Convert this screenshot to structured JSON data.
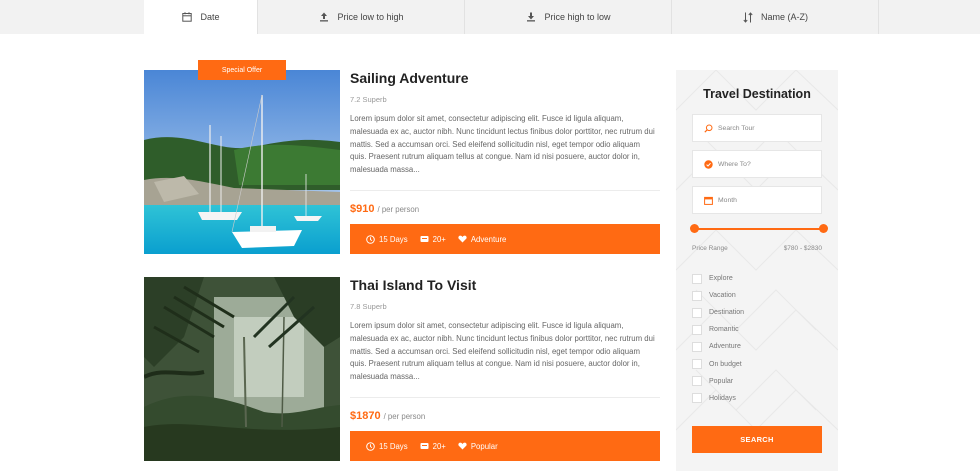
{
  "sort_tabs": [
    {
      "label": "Date",
      "icon": "calendar-icon",
      "active": true
    },
    {
      "label": "Price low to high",
      "icon": "upload-arrow-icon",
      "active": false
    },
    {
      "label": "Price high to low",
      "icon": "download-arrow-icon",
      "active": false
    },
    {
      "label": "Name (A-Z)",
      "icon": "sort-alpha-icon",
      "active": false
    }
  ],
  "listings": [
    {
      "badge": "Special Offer",
      "title": "Sailing Adventure",
      "rating": "7.2 Superb",
      "description": "Lorem ipsum dolor sit amet, consectetur adipiscing elit. Fusce id ligula aliquam, malesuada ex ac, auctor nibh. Nunc tincidunt lectus finibus dolor porttitor, nec rutrum dui mattis. Sed a accumsan orci. Sed eleifend sollicitudin nisl, eget tempor odio aliquam quis. Praesent rutrum aliquam tellus at congue. Nam id nisi posuere, auctor dolor in, malesuada massa...",
      "price": "$910",
      "price_unit": "/ per person",
      "duration": "15 Days",
      "group": "20+",
      "category": "Adventure",
      "image": "sailboats-in-turquoise-bay"
    },
    {
      "title": "Thai Island To Visit",
      "rating": "7.8 Superb",
      "description": "Lorem ipsum dolor sit amet, consectetur adipiscing elit. Fusce id ligula aliquam, malesuada ex ac, auctor nibh. Nunc tincidunt lectus finibus dolor porttitor, nec rutrum dui mattis. Sed a accumsan orci. Sed eleifend sollicitudin nisl, eget tempor odio aliquam quis. Praesent rutrum aliquam tellus at congue. Nam id nisi posuere, auctor dolor in, malesuada massa...",
      "price": "$1870",
      "price_unit": "/ per person",
      "duration": "15 Days",
      "group": "20+",
      "category": "Popular",
      "image": "tropical-jungle"
    }
  ],
  "sidebar": {
    "title": "Travel Destination",
    "search_placeholder": "Search Tour",
    "where_placeholder": "Where To?",
    "month_placeholder": "Month",
    "price_range_label": "Price Range",
    "price_range_value": "$780 - $2830",
    "categories": [
      "Explore",
      "Vacation",
      "Destination",
      "Romantic",
      "Adventure",
      "On budget",
      "Popular",
      "Holidays"
    ],
    "search_button": "SEARCH"
  },
  "colors": {
    "accent": "#ff6a13",
    "sidebar_bg": "#f4f4f4",
    "sortbar_bg": "#f2f2f2"
  }
}
